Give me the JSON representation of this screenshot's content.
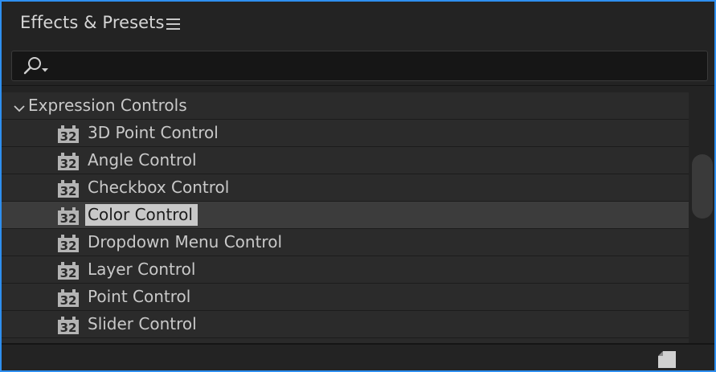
{
  "panel": {
    "title": "Effects & Presets",
    "accent_color": "#2e8ff0"
  },
  "search": {
    "value": "",
    "placeholder": ""
  },
  "tree": {
    "group": {
      "label": "Expression Controls",
      "expanded": true
    },
    "badge_text": "32",
    "items": [
      {
        "label": "3D Point Control",
        "selected": false
      },
      {
        "label": "Angle Control",
        "selected": false
      },
      {
        "label": "Checkbox Control",
        "selected": false
      },
      {
        "label": "Color Control",
        "selected": true
      },
      {
        "label": "Dropdown Menu Control",
        "selected": false
      },
      {
        "label": "Layer Control",
        "selected": false
      },
      {
        "label": "Point Control",
        "selected": false
      },
      {
        "label": "Slider Control",
        "selected": false
      }
    ]
  },
  "icons": {
    "panel_menu": "hamburger-menu-icon",
    "search": "search-icon",
    "group_toggle": "chevron-down-icon",
    "item_badge": "32-bit-badge-icon",
    "footer_action": "new-bin-icon"
  }
}
